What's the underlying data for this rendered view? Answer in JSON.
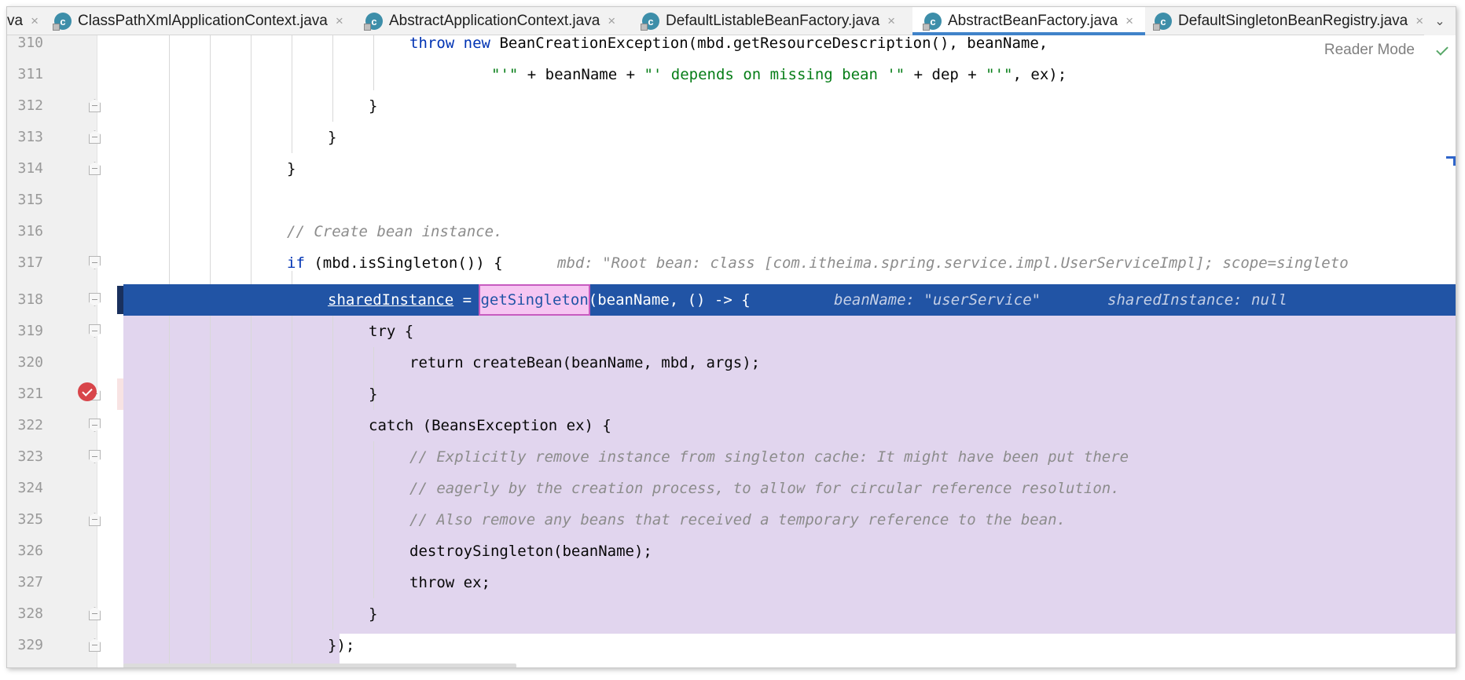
{
  "tabs": [
    {
      "label": "va",
      "icon": "class-icon",
      "active": false
    },
    {
      "label": "ClassPathXmlApplicationContext.java",
      "icon": "class-icon",
      "active": false
    },
    {
      "label": "AbstractApplicationContext.java",
      "icon": "class-icon",
      "active": false
    },
    {
      "label": "DefaultListableBeanFactory.java",
      "icon": "class-icon",
      "active": false
    },
    {
      "label": "AbstractBeanFactory.java",
      "icon": "class-icon",
      "active": true
    },
    {
      "label": "DefaultSingletonBeanRegistry.java",
      "icon": "class-icon",
      "active": false
    }
  ],
  "tab_icon_letter": "c",
  "close_glyph": "×",
  "more_tabs_glyph": "⌄",
  "reader_mode_label": "Reader Mode",
  "lines": [
    {
      "num": "310"
    },
    {
      "num": "311"
    },
    {
      "num": "312"
    },
    {
      "num": "313"
    },
    {
      "num": "314"
    },
    {
      "num": "315"
    },
    {
      "num": "316"
    },
    {
      "num": "317"
    },
    {
      "num": "318"
    },
    {
      "num": "319"
    },
    {
      "num": "320"
    },
    {
      "num": "321"
    },
    {
      "num": "322"
    },
    {
      "num": "323"
    },
    {
      "num": "324"
    },
    {
      "num": "325"
    },
    {
      "num": "326"
    },
    {
      "num": "327"
    },
    {
      "num": "328"
    },
    {
      "num": "329"
    }
  ],
  "code": {
    "l310_kw1": "throw",
    "l310_kw2": "new",
    "l310_rest": "BeanCreationException(mbd.getResourceDescription(), beanName,",
    "l311_s1": "\"'\"",
    "l311_p1": " + beanName + ",
    "l311_s2": "\"' depends on missing bean '\"",
    "l311_p2": " + dep + ",
    "l311_s3": "\"'\"",
    "l311_p3": ", ex);",
    "l312": "}",
    "l313": "}",
    "l314": "}",
    "l316": "// Create bean instance.",
    "l317_kw": "if",
    "l317_rest": " (mbd.isSingleton()) {",
    "l317_hint": "mbd: \"Root bean: class [com.itheima.spring.service.impl.UserServiceImpl]; scope=singleto",
    "l318_var": "sharedInstance",
    "l318_eq": " = ",
    "l318_method": "getSingleton",
    "l318_rest": "(beanName, () -> {",
    "l318_hint1": "beanName: \"userService\"",
    "l318_hint2": "sharedInstance: null",
    "l319": "try {",
    "l320": "return createBean(beanName, mbd, args);",
    "l321": "}",
    "l322": "catch (BeansException ex) {",
    "l323": "// Explicitly remove instance from singleton cache: It might have been put there",
    "l324": "// eagerly by the creation process, to allow for circular reference resolution.",
    "l325": "// Also remove any beans that received a temporary reference to the bean.",
    "l326": "destroySingleton(beanName);",
    "l327": "throw ex;",
    "l328": "}",
    "l329": "});"
  }
}
